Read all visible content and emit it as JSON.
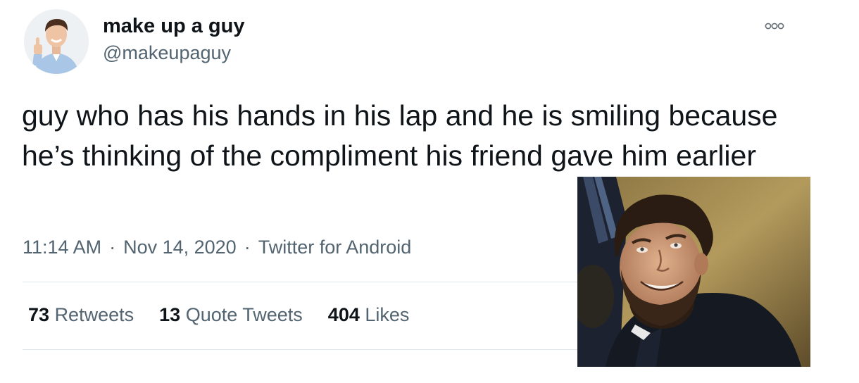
{
  "tweet": {
    "display_name": "make up a guy",
    "handle": "@makeupaguy",
    "text": "guy who has his hands in his lap and he is smiling because he’s thinking of the compliment his friend gave him earlier",
    "time": "11:14 AM",
    "date": "Nov 14, 2020",
    "source": "Twitter for Android",
    "separator": "·",
    "more_icon": "more-dots-icon"
  },
  "stats": {
    "retweets": {
      "count": "73",
      "label": "Retweets"
    },
    "quote_tweets": {
      "count": "13",
      "label": "Quote Tweets"
    },
    "likes": {
      "count": "404",
      "label": "Likes"
    }
  },
  "colors": {
    "text_primary": "#0f1419",
    "text_secondary": "#536471",
    "divider": "#e1e6ea"
  }
}
